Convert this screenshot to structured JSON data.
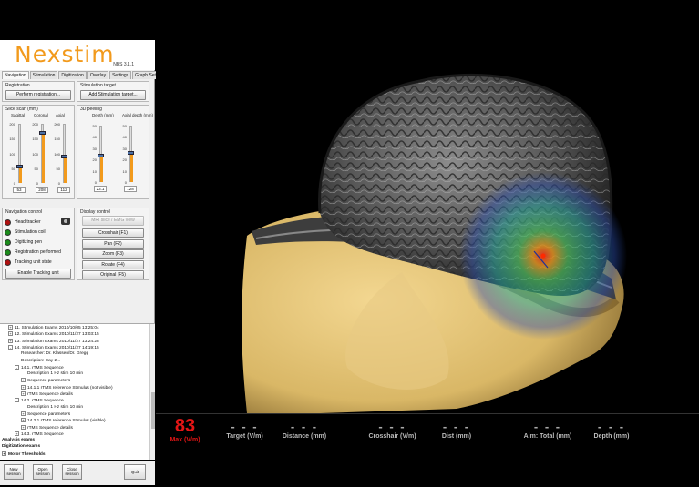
{
  "brand": {
    "logo": "Nexstim",
    "version": "NBS 3.1.1"
  },
  "tabs": [
    "Navigation",
    "Stimulation",
    "Digitization",
    "Overlay",
    "Settings",
    "Graph Settings"
  ],
  "registration": {
    "group_label": "Registration",
    "perform_button": "Perform registration...",
    "target_label": "Stimulation target",
    "add_target_button": "Add Stimulation target..."
  },
  "slice_scan": {
    "label": "Slice scan (mm)",
    "sliders": [
      {
        "name": "Sagittal",
        "value": "53",
        "level": 0.27
      },
      {
        "name": "Coronal",
        "value": "208",
        "level": 0.85
      },
      {
        "name": "Axial",
        "value": "112",
        "level": 0.45
      }
    ],
    "ticks": [
      "200",
      "150",
      "100",
      "50",
      "0"
    ]
  },
  "peeling": {
    "label": "3D peeling",
    "sliders": [
      {
        "name": "Depth (mm)",
        "value": "23.1",
        "level": 0.46
      },
      {
        "name": "Axial depth (mm)",
        "value": "128",
        "level": 0.52
      }
    ],
    "ticks": [
      "50",
      "40",
      "30",
      "20",
      "10",
      "0"
    ]
  },
  "navigation_control": {
    "label": "Navigation control",
    "items": [
      {
        "text": "Head tracker",
        "color": "#b01010"
      },
      {
        "text": "Stimulation coil",
        "color": "#1a8a1a"
      },
      {
        "text": "Digitizing pen",
        "color": "#1a8a1a"
      },
      {
        "text": "Registration performed",
        "color": "#1a8a1a"
      },
      {
        "text": "Tracking unit state",
        "color": "#b01010"
      }
    ],
    "enable_button": "Enable Tracking unit"
  },
  "display_control": {
    "label": "Display control",
    "mri_button": "MRI slice / EMG view",
    "buttons": [
      "Crosshair (F1)",
      "Pan (F2)",
      "Zoom (F3)",
      "Rotate (F4)",
      "Original (F5)"
    ]
  },
  "tree": {
    "items": [
      {
        "text": "11. Stimulation Exams 2010/10/05 13:25:04",
        "indent": 1,
        "exp": "+"
      },
      {
        "text": "12. Stimulation Exams 2010/11/27 13:03:15",
        "indent": 1,
        "exp": "+"
      },
      {
        "text": "13. Stimulation Exams 2010/11/27 13:24:28",
        "indent": 1,
        "exp": "+"
      },
      {
        "text": "14. Stimulation Exams 2010/11/27 14:19:15",
        "indent": 1,
        "exp": "-"
      },
      {
        "text": "Researcher: Dr. Klassen/Dr. Gregg",
        "indent": 3,
        "exp": ""
      },
      {
        "text": "Description: Day 2...",
        "indent": 3,
        "exp": ""
      },
      {
        "text": "14.1. rTMS Sequence",
        "indent": 2,
        "exp": "-"
      },
      {
        "text": "Description 1 Hz stim 10 min",
        "indent": 4,
        "exp": ""
      },
      {
        "text": "Sequence parameters",
        "indent": 3,
        "exp": "+"
      },
      {
        "text": "14.1.1 rTMS reference Stimulus (not visible)",
        "indent": 3,
        "exp": "+"
      },
      {
        "text": "rTMS Sequence details",
        "indent": 3,
        "exp": "+"
      },
      {
        "text": "14.2. rTMS Sequence",
        "indent": 2,
        "exp": "-"
      },
      {
        "text": "Description 1 Hz stim 10 min",
        "indent": 4,
        "exp": ""
      },
      {
        "text": "Sequence parameters",
        "indent": 3,
        "exp": "+"
      },
      {
        "text": "14.2.1 rTMS reference Stimulus (visible)",
        "indent": 3,
        "exp": "+"
      },
      {
        "text": "rTMS Sequence details",
        "indent": 3,
        "exp": "+"
      },
      {
        "text": "14.3. rTMS Sequence",
        "indent": 2,
        "exp": "+"
      },
      {
        "text": "Analysis exams",
        "indent": 0,
        "exp": "",
        "bold": true
      },
      {
        "text": "Digitization exams",
        "indent": 0,
        "exp": "",
        "bold": true
      },
      {
        "text": "Motor Thresholds",
        "indent": 0,
        "exp": "+",
        "bold": true
      }
    ]
  },
  "session_buttons": {
    "new": "New session",
    "open": "Open session",
    "close": "Close session",
    "quit": "Quit"
  },
  "metrics": [
    {
      "value": "83",
      "label": "Max (V/m)",
      "color": "#e31515"
    },
    {
      "value": "- - -",
      "label": "Target (V/m)"
    },
    {
      "value": "- - -",
      "label": "Distance (mm)"
    },
    {
      "value": "- - -",
      "label": "Crosshair (V/m)"
    },
    {
      "value": "- - -",
      "label": "Dist (mm)"
    },
    {
      "value": "- - -",
      "label": "Aim: Total (mm)"
    },
    {
      "value": "- - -",
      "label": "Depth (mm)"
    }
  ],
  "icons": {
    "camera": "camera-icon"
  }
}
